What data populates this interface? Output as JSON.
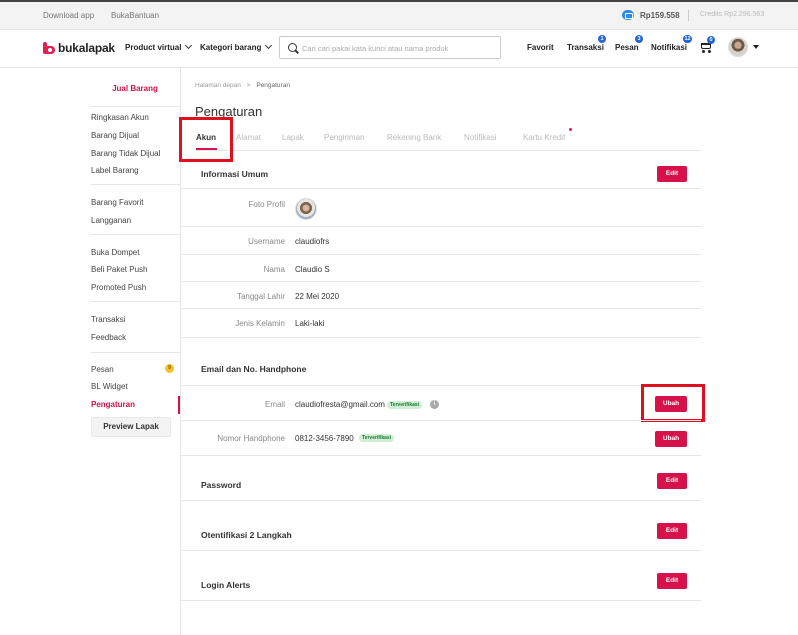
{
  "topstrip": {
    "download_app": "Download app",
    "bukabantuan": "BukaBantuan",
    "balance": "Rp159.558",
    "credits": "Credits Rp2.296.563"
  },
  "header": {
    "logo_text": "bukalapak",
    "product_virtual": "Product virtual",
    "kategori_barang": "Kategori barang",
    "search_placeholder": "Cari cari pakai kata kunci atau nama produk",
    "favorit": "Favorit",
    "transaksi": "Transaksi",
    "transaksi_badge": "1",
    "pesan": "Pesan",
    "pesan_badge": "3",
    "notifikasi": "Notifikasi",
    "notifikasi_badge": "12",
    "cart_badge": "0"
  },
  "sidebar": {
    "jual_barang": "Jual Barang",
    "group1": [
      "Ringkasan Akun",
      "Barang Dijual",
      "Barang Tidak Dijual",
      "Label Barang"
    ],
    "group2": [
      "Barang Favorit",
      "Langganan"
    ],
    "group3": [
      "Buka Dompet",
      "Beli Paket Push",
      "Promoted Push"
    ],
    "group4": [
      "Transaksi",
      "Feedback"
    ],
    "group5": [
      "Pesan",
      "BL Widget",
      "Pengaturan"
    ],
    "pesan_badge": "9",
    "preview_lapak": "Preview Lapak"
  },
  "main": {
    "breadcrumb_home": "Halaman depan",
    "breadcrumb_sep": ">",
    "breadcrumb_current": "Pengaturan",
    "page_title": "Pengaturan",
    "tabs": [
      "Akun",
      "Alamat",
      "Lapak",
      "Pengiriman",
      "Rekening Bank",
      "Notifikasi",
      "Kartu Kredit"
    ],
    "info_umum": {
      "title": "Informasi Umum",
      "edit": "Edit",
      "foto_profil_label": "Foto Profil",
      "username_label": "Username",
      "username": "claudiofrs",
      "nama_label": "Nama",
      "nama": "Claudio S",
      "tanggal_lahir_label": "Tanggal Lahir",
      "tanggal_lahir": "22 Mei 2020",
      "jenis_kelamin_label": "Jenis Kelamin",
      "jenis_kelamin": "Laki-laki"
    },
    "email_hp": {
      "title": "Email dan No. Handphone",
      "email_label": "Email",
      "email": "claudiofresta@gmail.com",
      "email_status": "Terverifikasi",
      "ubah": "Ubah",
      "hp_label": "Nomor Handphone",
      "hp": "0812-3456-7890",
      "hp_status": "Terverifikasi"
    },
    "password": {
      "title": "Password",
      "edit": "Edit"
    },
    "otentifikasi": {
      "title": "Otentifikasi 2 Langkah",
      "edit": "Edit"
    },
    "login_alerts": {
      "title": "Login Alerts",
      "edit": "Edit"
    }
  },
  "colors": {
    "accent": "#d71149",
    "highlight": "#e01020",
    "badge": "#2466d6",
    "verified": "#cfeed5"
  }
}
